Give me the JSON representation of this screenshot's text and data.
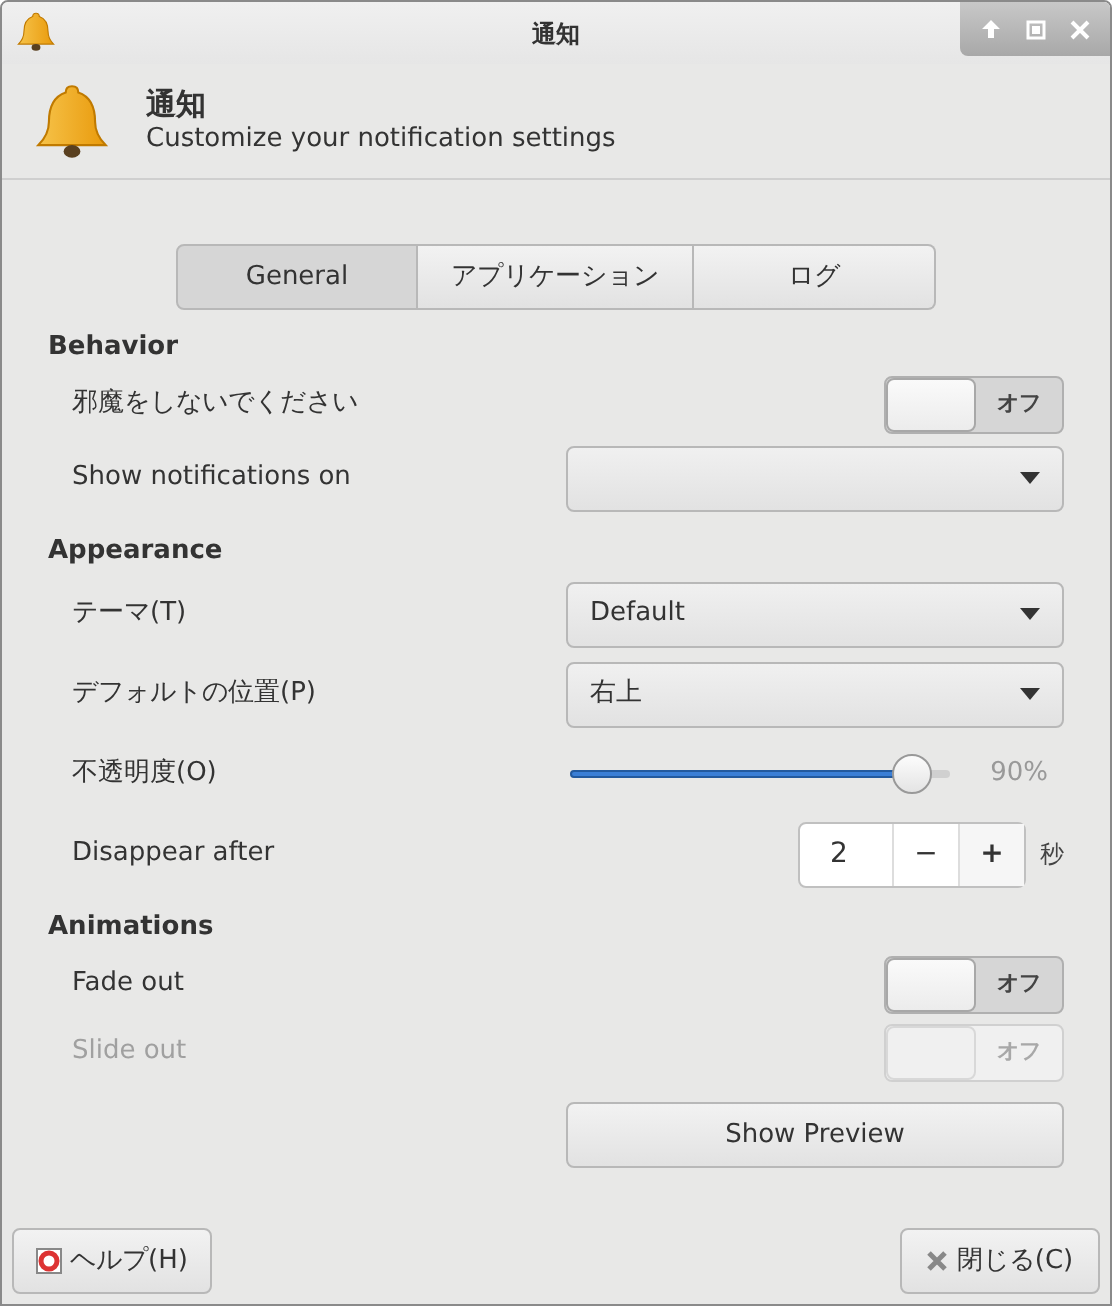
{
  "window": {
    "title": "通知"
  },
  "header": {
    "title": "通知",
    "subtitle": "Customize your notification settings"
  },
  "tabs": [
    {
      "label": "General",
      "selected": true
    },
    {
      "label": "アプリケーション",
      "selected": false
    },
    {
      "label": "ログ",
      "selected": false
    }
  ],
  "sections": [
    {
      "title": "Behavior",
      "rows": [
        {
          "kind": "switch",
          "label": "邪魔をしないでください",
          "on": false,
          "state_label": "オフ",
          "disabled": false
        },
        {
          "kind": "dropdown",
          "label": "Show notifications on"
        }
      ]
    },
    {
      "title": "Appearance",
      "rows": [
        {
          "kind": "dropdown",
          "label": "テーマ(T)",
          "value": "Default"
        },
        {
          "kind": "dropdown",
          "label": "デフォルトの位置(P)",
          "value": "右上"
        },
        {
          "kind": "slider",
          "label": "不透明度(O)",
          "level": 0.9,
          "reading": "90%"
        },
        {
          "kind": "spin",
          "label": "Disappear after",
          "value": "2",
          "minus": "−",
          "plus": "+",
          "unit": "秒"
        }
      ]
    },
    {
      "title": "Animations",
      "rows": [
        {
          "kind": "switch",
          "label": "Fade out",
          "on": false,
          "state_label": "オフ",
          "disabled": false
        },
        {
          "kind": "switch",
          "label": "Slide out",
          "on": false,
          "state_label": "オフ",
          "disabled": true
        },
        {
          "kind": "button",
          "label": "Show Preview"
        }
      ]
    }
  ],
  "footer": {
    "help": "ヘルプ(H)",
    "close": "閉じる(C)"
  }
}
